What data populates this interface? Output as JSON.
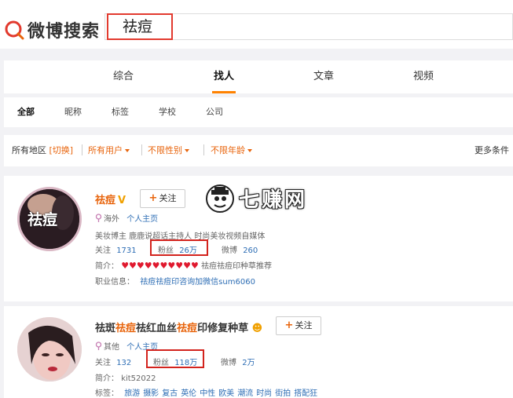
{
  "header": {
    "logo_text": "微博搜索",
    "search_value": "祛痘"
  },
  "tabs": [
    {
      "label": "综合"
    },
    {
      "label": "找人"
    },
    {
      "label": "文章"
    },
    {
      "label": "视频"
    }
  ],
  "subtabs": [
    {
      "label": "全部"
    },
    {
      "label": "昵称"
    },
    {
      "label": "标签"
    },
    {
      "label": "学校"
    },
    {
      "label": "公司"
    }
  ],
  "filters": {
    "region_label": "所有地区",
    "region_switch": "[切换]",
    "users": "所有用户",
    "gender": "不限性别",
    "age": "不限年龄",
    "more": "更多条件"
  },
  "watermark": {
    "text": "七赚网"
  },
  "results": [
    {
      "avatar_text": "祛痘",
      "name": "祛痘",
      "location": "海外",
      "homepage": "个人主页",
      "bio": "美妆博主 鹿鹿说超话主持人 时尚美妆视频自媒体",
      "follow_label": "关注",
      "follow_count": "1731",
      "fans_label": "粉丝",
      "fans_count": "26万",
      "weibo_label": "微博",
      "weibo_count": "260",
      "intro_label": "简介：",
      "intro_text": "祛痘祛痘印种草推荐",
      "hearts": "♥♥♥♥♥♥♥♥♥♥",
      "job_label": "职业信息：",
      "job_text": "祛痘祛痘印咨询加微信sum6060",
      "follow_button": "关注"
    },
    {
      "name_parts": [
        "祛斑",
        "祛痘",
        "祛红血丝",
        "祛痘",
        "印修复种草"
      ],
      "location": "其他",
      "homepage": "个人主页",
      "follow_label": "关注",
      "follow_count": "132",
      "fans_label": "粉丝",
      "fans_count": "118万",
      "weibo_label": "微博",
      "weibo_count": "2万",
      "intro_label": "简介：",
      "intro_text": "kit52022",
      "tags_label": "标签：",
      "tags": [
        "旅游",
        "摄影",
        "复古",
        "英伦",
        "中性",
        "欧美",
        "潮流",
        "时尚",
        "街拍",
        "搭配狂"
      ],
      "follow_button": "关注"
    }
  ],
  "colors": {
    "accent": "#ff8200",
    "highlight": "#e8640c",
    "link": "#2e6eb5",
    "annotation_red": "#d3231d"
  }
}
